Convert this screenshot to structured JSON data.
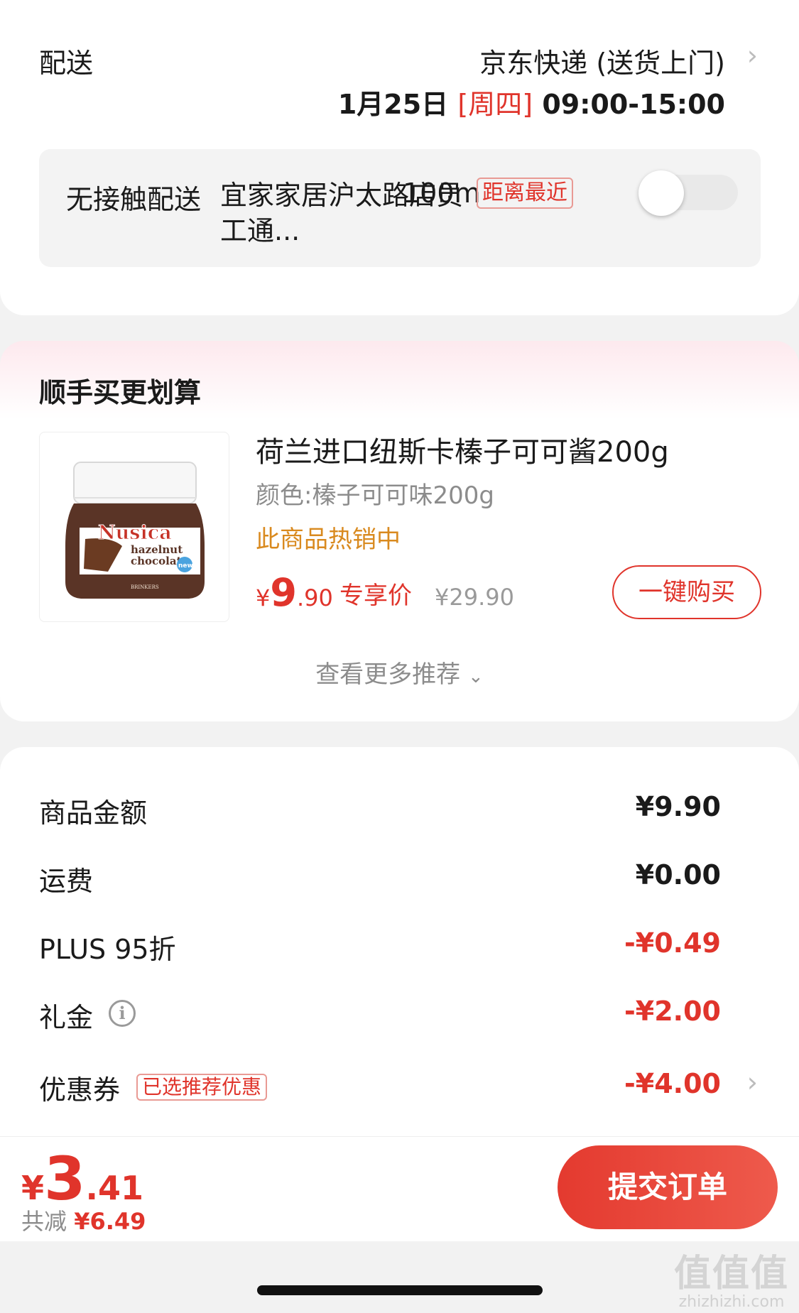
{
  "delivery": {
    "label": "配送",
    "method": "京东快递 (送货上门)",
    "date": "1月25日",
    "weekday": "[周四]",
    "window": "09:00-15:00",
    "contactless": {
      "label": "无接触配送",
      "store": "宜家家居沪太路店员工通...",
      "distance": "100m",
      "badge": "距离最近",
      "enabled": false
    }
  },
  "recommend": {
    "title": "顺手买更划算",
    "product": {
      "name": "荷兰进口纽斯卡榛子可可酱200g",
      "spec": "颜色:榛子可可味200g",
      "hot": "此商品热销中",
      "price_currency": "¥",
      "price_int": "9",
      "price_dec": ".90",
      "price_tag": "专享价",
      "orig_price": "¥29.90",
      "buy_label": "一键购买",
      "image": {
        "brand": "Nusica",
        "line1": "hazelnut",
        "line2": "chocolate",
        "badge": "new",
        "maker": "BRINKERS"
      }
    },
    "more_label": "查看更多推荐"
  },
  "summary": {
    "rows": [
      {
        "label": "商品金额",
        "value": "¥9.90"
      },
      {
        "label": "运费",
        "value": "¥0.00"
      },
      {
        "label": "PLUS 95折",
        "value": "-¥0.49"
      },
      {
        "label": "礼金",
        "value": "-¥2.00"
      },
      {
        "label": "优惠券",
        "value": "-¥4.00",
        "badge": "已选推荐优惠"
      }
    ]
  },
  "footer": {
    "total_currency": "¥",
    "total_int": "3",
    "total_dec": ".41",
    "saved_label": "共减",
    "saved_amount": "¥6.49",
    "submit_label": "提交订单"
  },
  "watermark": {
    "logo": "值值值",
    "url": "zhizhizhi.com"
  },
  "colors": {
    "accent": "#e0342b",
    "hot": "#d98a1f",
    "muted": "#8c8c8c"
  }
}
